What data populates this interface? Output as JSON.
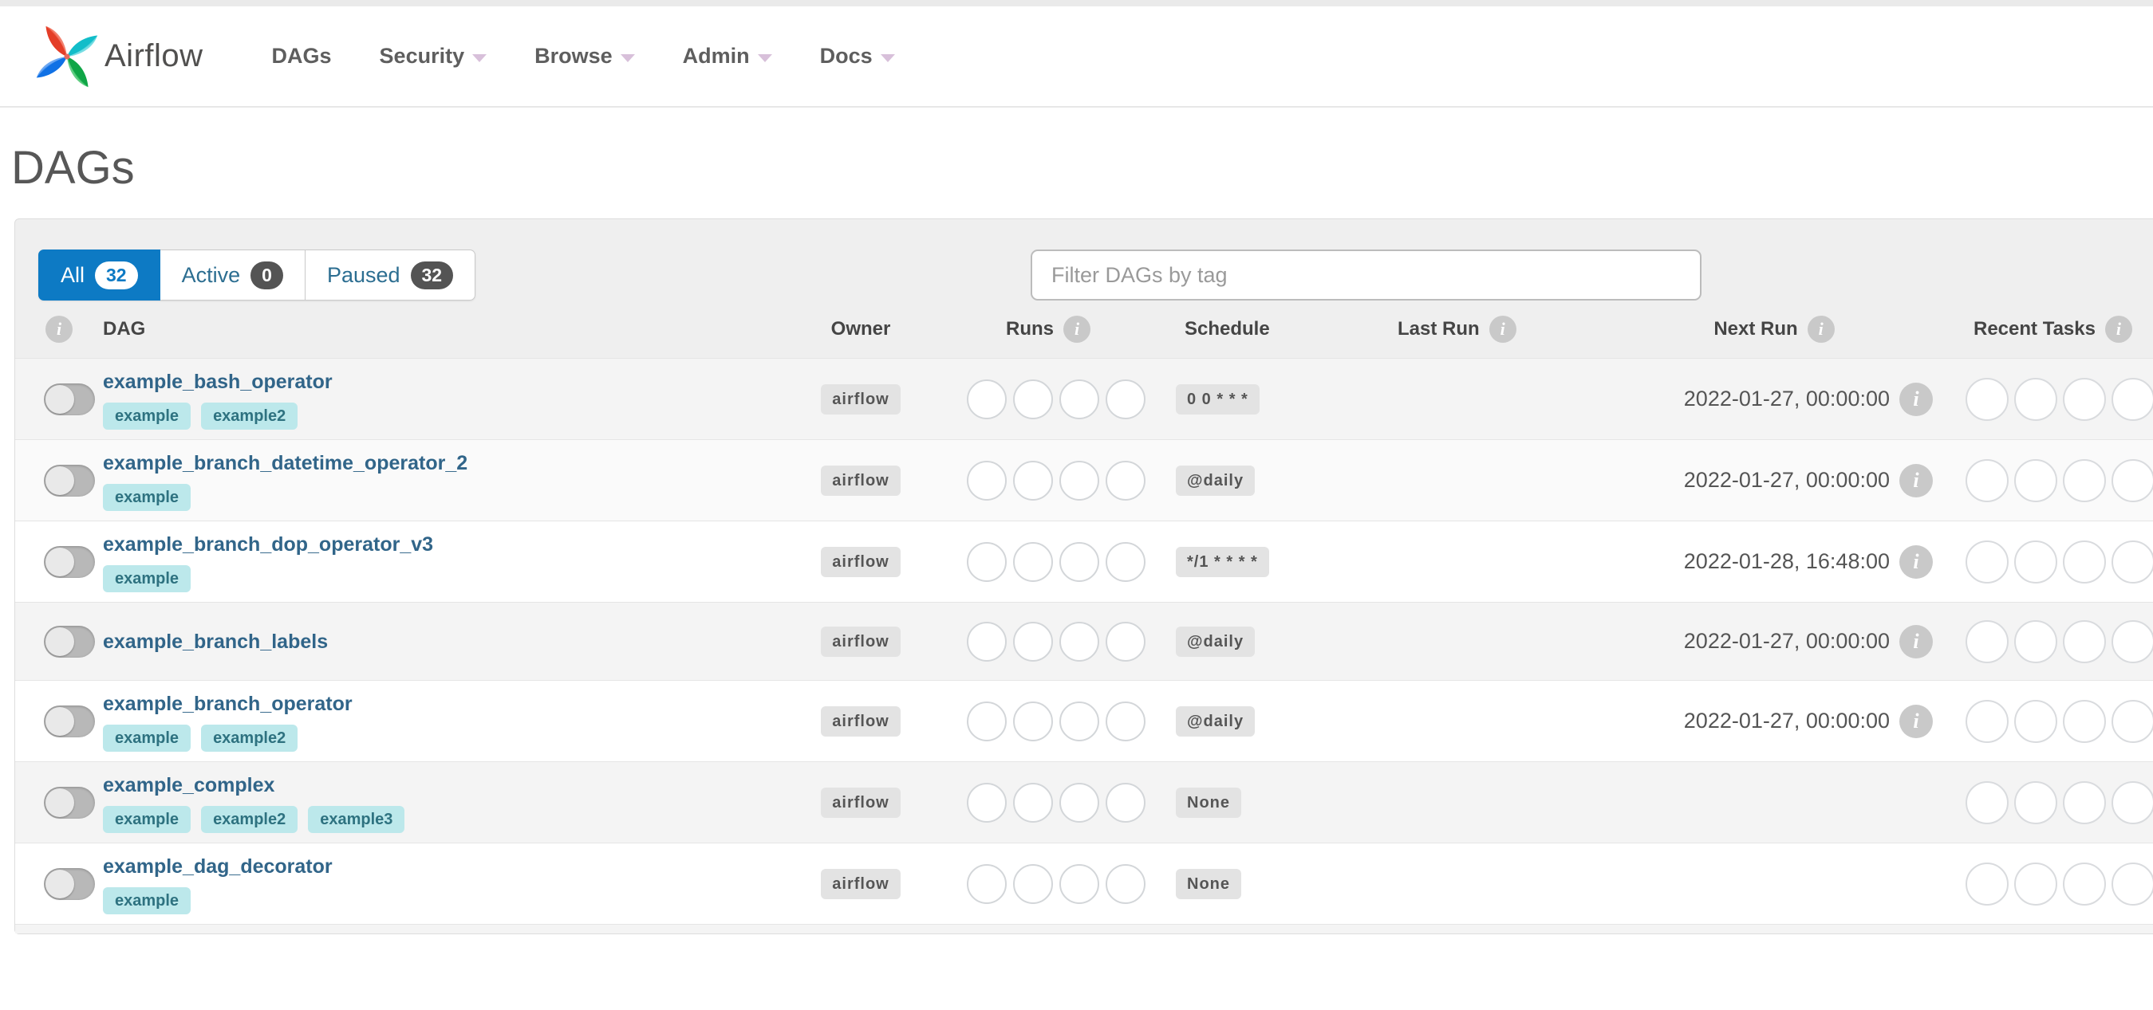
{
  "navbar": {
    "brand": "Airflow",
    "items": [
      {
        "label": "DAGs",
        "caret": false
      },
      {
        "label": "Security",
        "caret": true
      },
      {
        "label": "Browse",
        "caret": true
      },
      {
        "label": "Admin",
        "caret": true
      },
      {
        "label": "Docs",
        "caret": true
      }
    ]
  },
  "page": {
    "title": "DAGs"
  },
  "tabs": [
    {
      "label": "All",
      "count": "32",
      "active": true
    },
    {
      "label": "Active",
      "count": "0",
      "active": false
    },
    {
      "label": "Paused",
      "count": "32",
      "active": false
    }
  ],
  "filter": {
    "placeholder": "Filter DAGs by tag"
  },
  "table": {
    "headers": {
      "dag": "DAG",
      "owner": "Owner",
      "runs": "Runs",
      "schedule": "Schedule",
      "last_run": "Last Run",
      "next_run": "Next Run",
      "recent_tasks": "Recent Tasks"
    },
    "run_state_slots": 4,
    "recent_task_slots": 5,
    "rows": [
      {
        "name": "example_bash_operator",
        "tags": [
          "example",
          "example2"
        ],
        "owner": "airflow",
        "schedule": "0 0 * * *",
        "last_run": "",
        "next_run": "2022-01-27, 00:00:00",
        "paused": true,
        "shade": "#f4f4f4"
      },
      {
        "name": "example_branch_datetime_operator_2",
        "tags": [
          "example"
        ],
        "owner": "airflow",
        "schedule": "@daily",
        "last_run": "",
        "next_run": "2022-01-27, 00:00:00",
        "paused": true,
        "shade": "#fafafa"
      },
      {
        "name": "example_branch_dop_operator_v3",
        "tags": [
          "example"
        ],
        "owner": "airflow",
        "schedule": "*/1 * * * *",
        "last_run": "",
        "next_run": "2022-01-28, 16:48:00",
        "paused": true,
        "shade": "#ffffff"
      },
      {
        "name": "example_branch_labels",
        "tags": [],
        "owner": "airflow",
        "schedule": "@daily",
        "last_run": "",
        "next_run": "2022-01-27, 00:00:00",
        "paused": true,
        "shade": "#f4f4f4"
      },
      {
        "name": "example_branch_operator",
        "tags": [
          "example",
          "example2"
        ],
        "owner": "airflow",
        "schedule": "@daily",
        "last_run": "",
        "next_run": "2022-01-27, 00:00:00",
        "paused": true,
        "shade": "#ffffff"
      },
      {
        "name": "example_complex",
        "tags": [
          "example",
          "example2",
          "example3"
        ],
        "owner": "airflow",
        "schedule": "None",
        "last_run": "",
        "next_run": "",
        "paused": true,
        "shade": "#f4f4f4"
      },
      {
        "name": "example_dag_decorator",
        "tags": [
          "example"
        ],
        "owner": "airflow",
        "schedule": "None",
        "last_run": "",
        "next_run": "",
        "paused": true,
        "shade": "#ffffff"
      }
    ]
  },
  "colors": {
    "accent_blue": "#0d7ac4",
    "link_blue": "#316589",
    "tag_bg": "#bce8eb",
    "tag_text": "#2e7280",
    "badge_bg": "#e3e3e3",
    "circle_border": "#d3d6d9"
  }
}
